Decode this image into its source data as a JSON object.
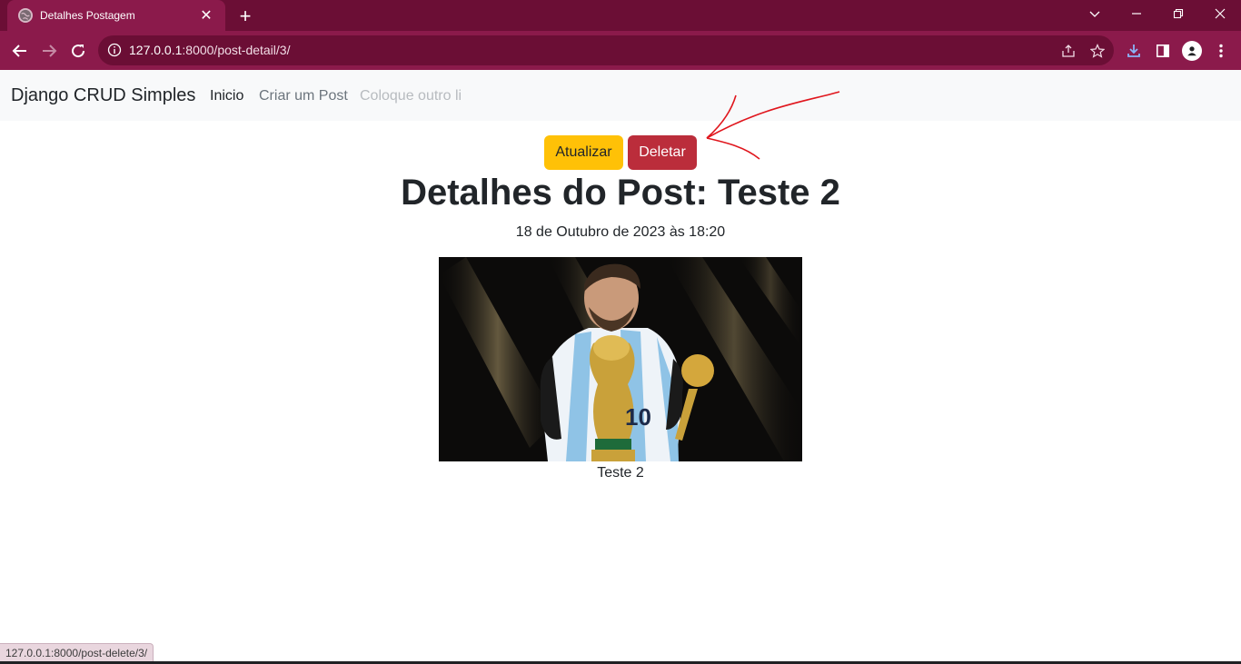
{
  "browser": {
    "tab": {
      "title": "Detalhes Postagem",
      "favicon": "globe-icon"
    },
    "url": {
      "host": "127.0.0.1",
      "rest": ":8000/post-detail/3/"
    },
    "colors": {
      "frame": "#6b0e35",
      "toolbar": "#8b1a4b"
    }
  },
  "navbar": {
    "brand": "Django CRUD Simples",
    "links": [
      {
        "label": "Inicio",
        "state": "active"
      },
      {
        "label": "Criar um Post",
        "state": "normal"
      },
      {
        "label": "Coloque outro li",
        "state": "disabled"
      }
    ]
  },
  "actions": {
    "update_label": "Atualizar",
    "delete_label": "Deletar"
  },
  "post": {
    "title": "Detalhes do Post: Teste 2",
    "date": "18 de Outubro de 2023 às 18:20",
    "caption": "Teste 2",
    "image_subject": "player-kissing-trophy-image"
  },
  "statusbar": {
    "text": "127.0.0.1:8000/post-delete/3/"
  }
}
